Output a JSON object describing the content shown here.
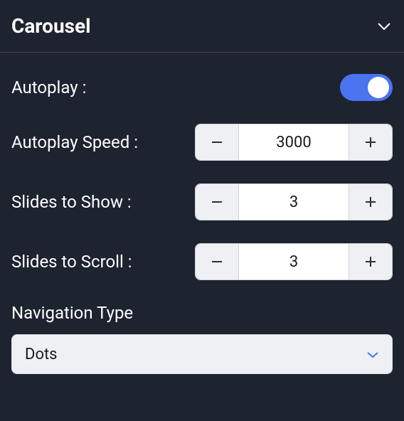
{
  "section": {
    "title": "Carousel"
  },
  "fields": {
    "autoplay": {
      "label": "Autoplay :",
      "value": true
    },
    "autoplay_speed": {
      "label": "Autoplay Speed :",
      "value": "3000"
    },
    "slides_to_show": {
      "label": "Slides to Show :",
      "value": "3"
    },
    "slides_to_scroll": {
      "label": "Slides to Scroll :",
      "value": "3"
    },
    "navigation_type": {
      "label": "Navigation Type",
      "value": "Dots"
    }
  },
  "colors": {
    "accent": "#4a74f0",
    "panel_bg": "#1e2330",
    "control_bg": "#eef0f3"
  }
}
